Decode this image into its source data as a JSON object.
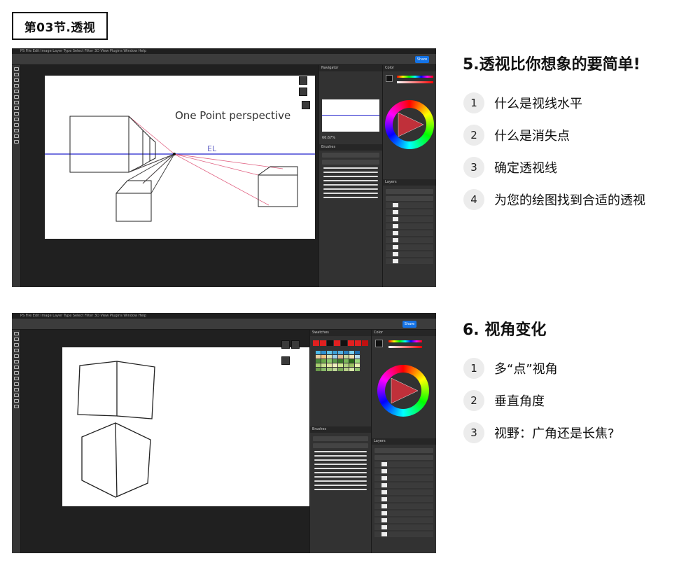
{
  "section_tag": "第03节.透视",
  "section5": {
    "title": "5.透视比你想象的要简单!",
    "items": [
      {
        "num": "1",
        "text": "什么是视线水平"
      },
      {
        "num": "2",
        "text": "什么是消失点"
      },
      {
        "num": "3",
        "text": "确定透视线"
      },
      {
        "num": "4",
        "text": "为您的绘图找到合适的透视"
      }
    ]
  },
  "section6": {
    "title": "6. 视角变化",
    "items": [
      {
        "num": "1",
        "text": "多“点”视角"
      },
      {
        "num": "2",
        "text": "垂直角度"
      },
      {
        "num": "3",
        "text": "视野：广角还是长焦?"
      }
    ]
  },
  "screenshot1": {
    "menu": "PS  File  Edit  Image  Layer  Type  Select  Filter  3D  View  Plugins  Window  Help",
    "share": "Share",
    "canvas_note": "One Point perspective",
    "eye_level_label": "EL",
    "panels": {
      "navigator": "Navigator",
      "color": "Color",
      "brushes": "Brushes",
      "layers": "Layers",
      "zoom": "66.67%"
    },
    "horizon_color": "#2222cc",
    "perspective_line_color": "#e06080"
  },
  "screenshot2": {
    "menu": "PS  File  Edit  Image  Layer  Type  Select  Filter  3D  View  Plugins  Window  Help",
    "share": "Share",
    "panels": {
      "swatches": "Swatches",
      "color": "Color",
      "brushes": "Brushes",
      "layers": "Layers"
    }
  }
}
